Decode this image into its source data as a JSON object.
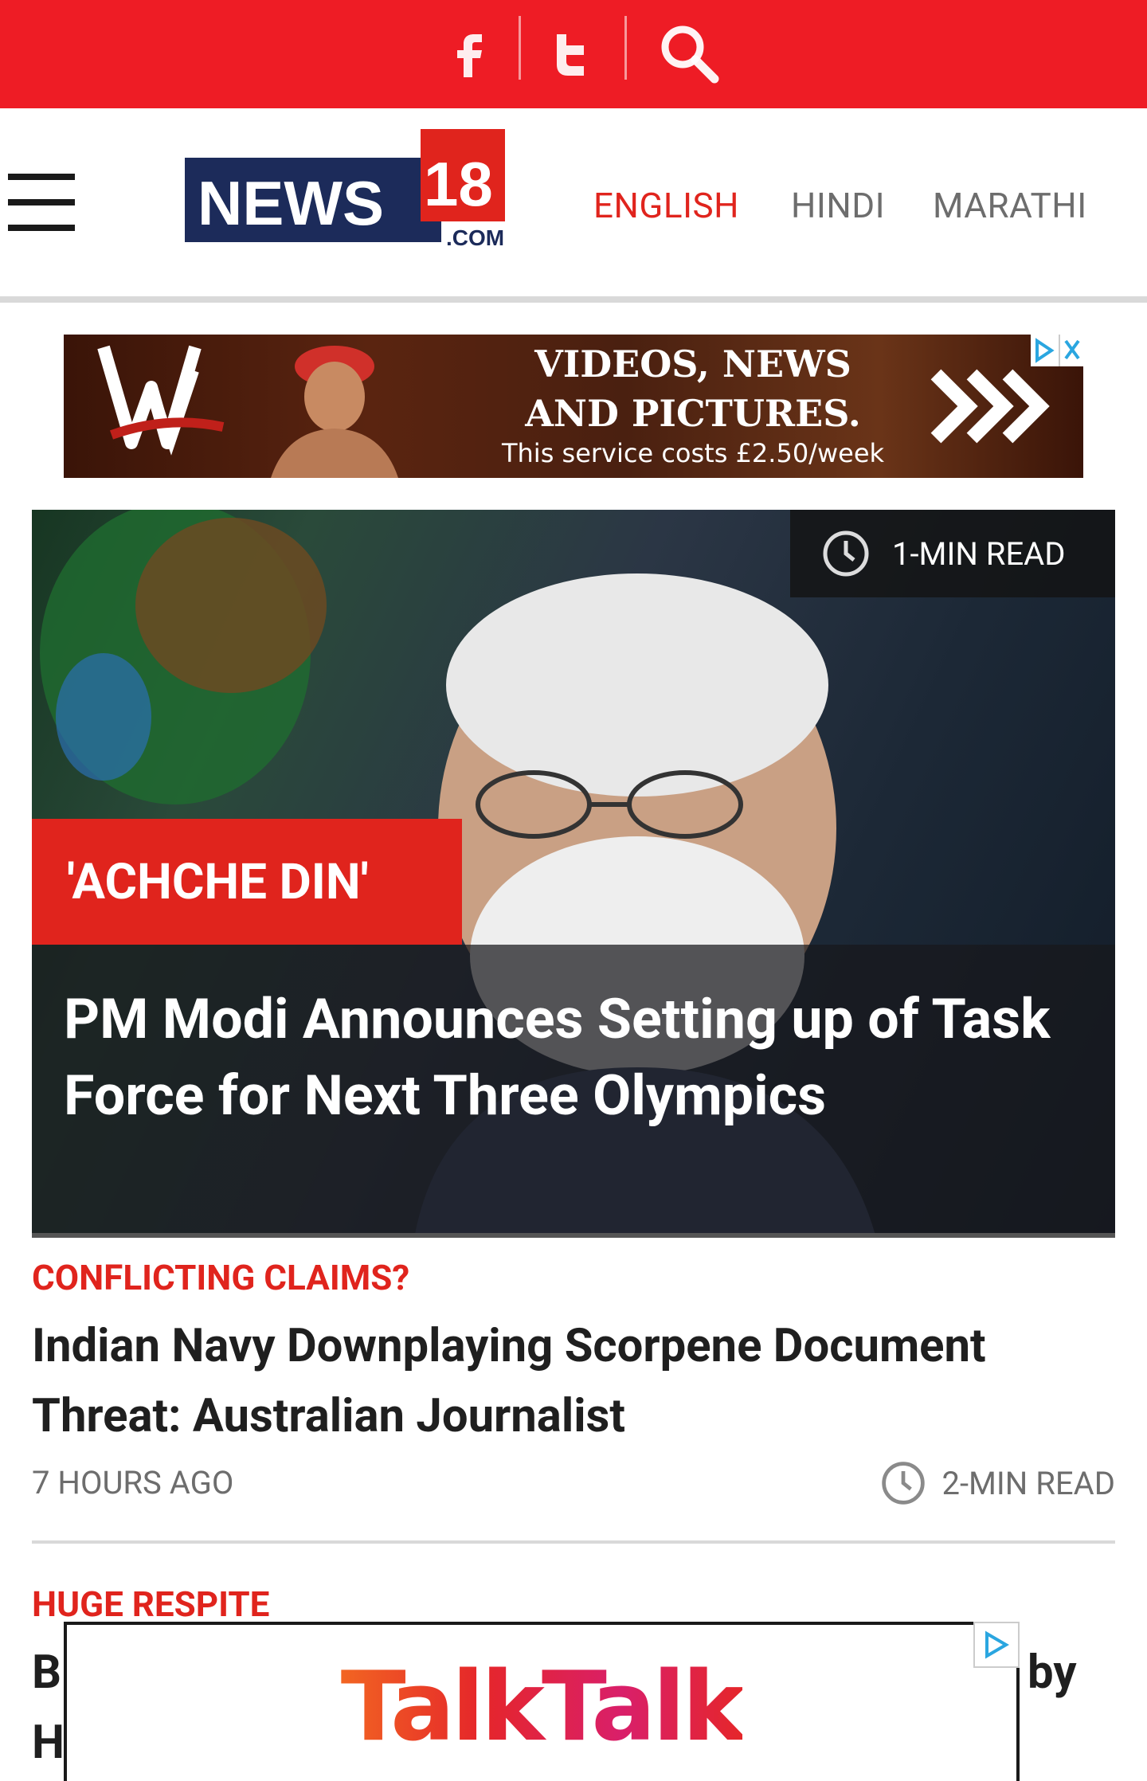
{
  "top_bar": {
    "color": "#ee1c25",
    "icons": [
      "facebook-icon",
      "twitter-icon",
      "search-icon"
    ]
  },
  "header": {
    "logo_text": "NEWS",
    "logo_number": "18",
    "logo_domain": ".COM",
    "languages": [
      {
        "label": "ENGLISH",
        "active": true
      },
      {
        "label": "HINDI",
        "active": false
      },
      {
        "label": "MARATHI",
        "active": false
      }
    ]
  },
  "banner_ad": {
    "line1": "VIDEOS, NEWS",
    "line2": "AND PICTURES.",
    "line3": "This service costs £2.50/week"
  },
  "hero": {
    "read_time": "1-MIN READ",
    "kicker": "'ACHCHE DIN'",
    "title": "PM Modi Announces Setting up of Task Force for Next Three Olympics"
  },
  "articles": [
    {
      "kicker": "CONFLICTING CLAIMS?",
      "title": "Indian Navy Downplaying Scorpene Document Threat: Australian Journalist",
      "time_ago": "7 HOURS AGO",
      "read_time": "2-MIN READ"
    },
    {
      "kicker": "HUGE RESPITE",
      "title_start_1": "B",
      "title_start_2": "H",
      "title_end_1": "by"
    }
  ],
  "bottom_ad": {
    "brand": "TalkTalk"
  },
  "colors": {
    "brand_red": "#e0241d",
    "topbar_red": "#ee1c25",
    "logo_navy": "#1c2b5a",
    "muted_text": "#6d6d6d"
  }
}
